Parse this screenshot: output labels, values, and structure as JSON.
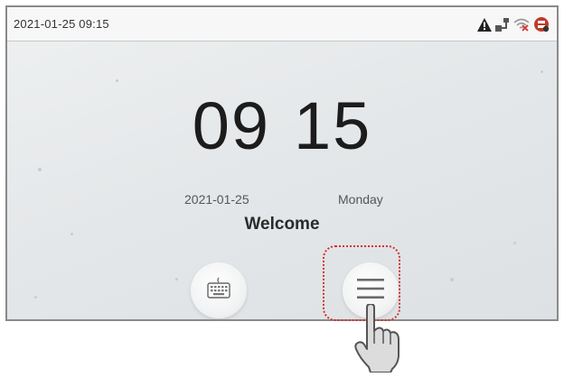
{
  "status_bar": {
    "datetime": "2021-01-25 09:15",
    "icons": [
      "warning-icon",
      "ethernet-icon",
      "wifi-off-icon",
      "cloud-server-icon"
    ]
  },
  "clock": {
    "hours": "09",
    "minutes": "15"
  },
  "date": "2021-01-25",
  "weekday": "Monday",
  "welcome": "Welcome",
  "buttons": [
    {
      "name": "keyboard-button",
      "icon": "keyboard-icon"
    },
    {
      "name": "menu-button",
      "icon": "menu-icon",
      "highlighted": true
    }
  ],
  "colors": {
    "highlight": "#d53030",
    "warning": "#222222",
    "wifi_off": "#d53030"
  }
}
